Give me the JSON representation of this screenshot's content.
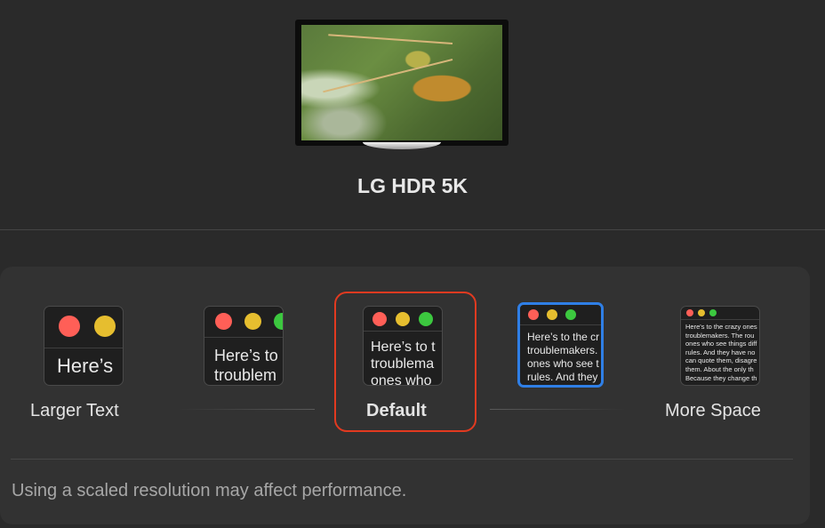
{
  "display": {
    "name": "LG HDR 5K",
    "wallpaper_icon": "praying-mantis-wallpaper"
  },
  "resolution_options": [
    {
      "label": "Larger Text",
      "preview_text": "Here’s",
      "selected": false
    },
    {
      "label": "",
      "preview_text": "Here’s to\ntroublem",
      "selected": false
    },
    {
      "label": "Default",
      "preview_text": "Here’s to t\ntroublema\nones who",
      "selected": true
    },
    {
      "label": "",
      "preview_text": "Here’s to the cr\ntroublemakers.\nones who see t\nrules. And they",
      "selected": false,
      "focused": true
    },
    {
      "label": "More Space",
      "preview_text": "Here's to the crazy ones\ntroublemakers. The rou\nones who see things diff\nrules. And they have no\ncan quote them, disagre\nthem. About the only th\nBecause they change th",
      "selected": false
    }
  ],
  "footer_note": "Using a scaled resolution may affect performance.",
  "colors": {
    "selection_ring": "#e23a20",
    "focus_ring": "#2f7fe6",
    "background": "#2a2a2a",
    "panel": "#323232"
  }
}
